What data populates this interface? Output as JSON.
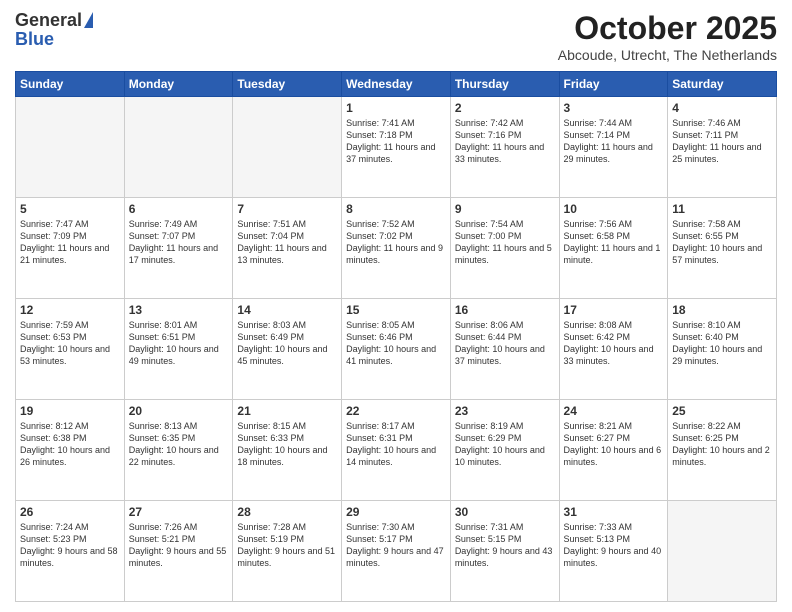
{
  "header": {
    "logo_general": "General",
    "logo_blue": "Blue",
    "month": "October 2025",
    "location": "Abcoude, Utrecht, The Netherlands"
  },
  "days_of_week": [
    "Sunday",
    "Monday",
    "Tuesday",
    "Wednesday",
    "Thursday",
    "Friday",
    "Saturday"
  ],
  "weeks": [
    [
      {
        "day": "",
        "empty": true
      },
      {
        "day": "",
        "empty": true
      },
      {
        "day": "",
        "empty": true
      },
      {
        "day": "1",
        "sunrise": "7:41 AM",
        "sunset": "7:18 PM",
        "daylight": "11 hours and 37 minutes."
      },
      {
        "day": "2",
        "sunrise": "7:42 AM",
        "sunset": "7:16 PM",
        "daylight": "11 hours and 33 minutes."
      },
      {
        "day": "3",
        "sunrise": "7:44 AM",
        "sunset": "7:14 PM",
        "daylight": "11 hours and 29 minutes."
      },
      {
        "day": "4",
        "sunrise": "7:46 AM",
        "sunset": "7:11 PM",
        "daylight": "11 hours and 25 minutes."
      }
    ],
    [
      {
        "day": "5",
        "sunrise": "7:47 AM",
        "sunset": "7:09 PM",
        "daylight": "11 hours and 21 minutes."
      },
      {
        "day": "6",
        "sunrise": "7:49 AM",
        "sunset": "7:07 PM",
        "daylight": "11 hours and 17 minutes."
      },
      {
        "day": "7",
        "sunrise": "7:51 AM",
        "sunset": "7:04 PM",
        "daylight": "11 hours and 13 minutes."
      },
      {
        "day": "8",
        "sunrise": "7:52 AM",
        "sunset": "7:02 PM",
        "daylight": "11 hours and 9 minutes."
      },
      {
        "day": "9",
        "sunrise": "7:54 AM",
        "sunset": "7:00 PM",
        "daylight": "11 hours and 5 minutes."
      },
      {
        "day": "10",
        "sunrise": "7:56 AM",
        "sunset": "6:58 PM",
        "daylight": "11 hours and 1 minute."
      },
      {
        "day": "11",
        "sunrise": "7:58 AM",
        "sunset": "6:55 PM",
        "daylight": "10 hours and 57 minutes."
      }
    ],
    [
      {
        "day": "12",
        "sunrise": "7:59 AM",
        "sunset": "6:53 PM",
        "daylight": "10 hours and 53 minutes."
      },
      {
        "day": "13",
        "sunrise": "8:01 AM",
        "sunset": "6:51 PM",
        "daylight": "10 hours and 49 minutes."
      },
      {
        "day": "14",
        "sunrise": "8:03 AM",
        "sunset": "6:49 PM",
        "daylight": "10 hours and 45 minutes."
      },
      {
        "day": "15",
        "sunrise": "8:05 AM",
        "sunset": "6:46 PM",
        "daylight": "10 hours and 41 minutes."
      },
      {
        "day": "16",
        "sunrise": "8:06 AM",
        "sunset": "6:44 PM",
        "daylight": "10 hours and 37 minutes."
      },
      {
        "day": "17",
        "sunrise": "8:08 AM",
        "sunset": "6:42 PM",
        "daylight": "10 hours and 33 minutes."
      },
      {
        "day": "18",
        "sunrise": "8:10 AM",
        "sunset": "6:40 PM",
        "daylight": "10 hours and 29 minutes."
      }
    ],
    [
      {
        "day": "19",
        "sunrise": "8:12 AM",
        "sunset": "6:38 PM",
        "daylight": "10 hours and 26 minutes."
      },
      {
        "day": "20",
        "sunrise": "8:13 AM",
        "sunset": "6:35 PM",
        "daylight": "10 hours and 22 minutes."
      },
      {
        "day": "21",
        "sunrise": "8:15 AM",
        "sunset": "6:33 PM",
        "daylight": "10 hours and 18 minutes."
      },
      {
        "day": "22",
        "sunrise": "8:17 AM",
        "sunset": "6:31 PM",
        "daylight": "10 hours and 14 minutes."
      },
      {
        "day": "23",
        "sunrise": "8:19 AM",
        "sunset": "6:29 PM",
        "daylight": "10 hours and 10 minutes."
      },
      {
        "day": "24",
        "sunrise": "8:21 AM",
        "sunset": "6:27 PM",
        "daylight": "10 hours and 6 minutes."
      },
      {
        "day": "25",
        "sunrise": "8:22 AM",
        "sunset": "6:25 PM",
        "daylight": "10 hours and 2 minutes."
      }
    ],
    [
      {
        "day": "26",
        "sunrise": "7:24 AM",
        "sunset": "5:23 PM",
        "daylight": "9 hours and 58 minutes."
      },
      {
        "day": "27",
        "sunrise": "7:26 AM",
        "sunset": "5:21 PM",
        "daylight": "9 hours and 55 minutes."
      },
      {
        "day": "28",
        "sunrise": "7:28 AM",
        "sunset": "5:19 PM",
        "daylight": "9 hours and 51 minutes."
      },
      {
        "day": "29",
        "sunrise": "7:30 AM",
        "sunset": "5:17 PM",
        "daylight": "9 hours and 47 minutes."
      },
      {
        "day": "30",
        "sunrise": "7:31 AM",
        "sunset": "5:15 PM",
        "daylight": "9 hours and 43 minutes."
      },
      {
        "day": "31",
        "sunrise": "7:33 AM",
        "sunset": "5:13 PM",
        "daylight": "9 hours and 40 minutes."
      },
      {
        "day": "",
        "empty": true
      }
    ]
  ]
}
